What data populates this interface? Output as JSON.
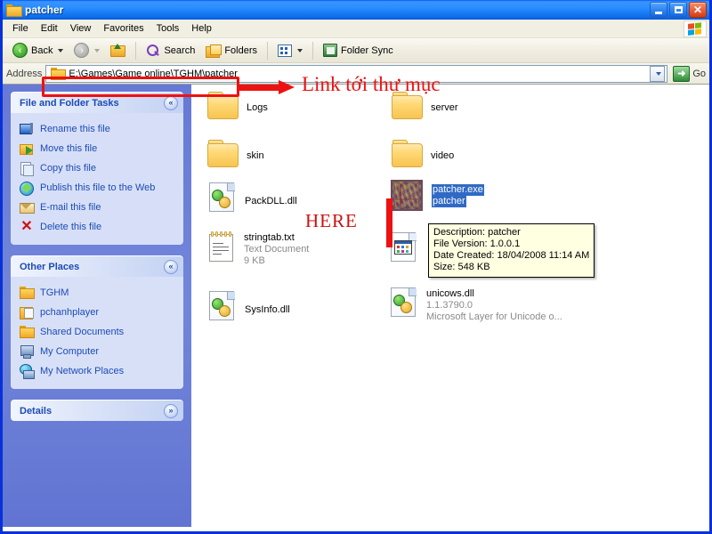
{
  "window": {
    "title": "patcher",
    "title_icon": "folder-icon",
    "buttons": {
      "minimize": "_",
      "maximize": "□",
      "close": "✕"
    }
  },
  "menu": {
    "items": [
      {
        "label": "File",
        "accel": "F"
      },
      {
        "label": "Edit",
        "accel": "E"
      },
      {
        "label": "View",
        "accel": "V"
      },
      {
        "label": "Favorites",
        "accel": "a"
      },
      {
        "label": "Tools",
        "accel": "T"
      },
      {
        "label": "Help",
        "accel": "H"
      }
    ],
    "flag_icon": "windows-flag-icon"
  },
  "toolbar": {
    "back_label": "Back",
    "back_icon": "back-arrow-icon",
    "forward_icon": "forward-arrow-icon",
    "up_icon": "up-folder-icon",
    "search_label": "Search",
    "search_icon": "search-icon",
    "folders_label": "Folders",
    "folders_icon": "folders-icon",
    "views_icon": "views-icon",
    "folder_sync_label": "Folder Sync",
    "folder_sync_icon": "folder-sync-icon"
  },
  "address": {
    "label": "Address",
    "value": "E:\\Games\\Game online\\TGHM\\patcher",
    "icon": "folder-icon",
    "dropdown_icon": "chevron-down-icon",
    "go_label": "Go",
    "go_icon": "go-arrow-icon"
  },
  "sidebar": {
    "panels": [
      {
        "title": "File and Folder Tasks",
        "collapse_icon": "chevron-up-icon",
        "collapse_glyph": "«",
        "items": [
          {
            "label": "Rename this file",
            "icon": "rename-icon"
          },
          {
            "label": "Move this file",
            "icon": "move-icon"
          },
          {
            "label": "Copy this file",
            "icon": "copy-icon"
          },
          {
            "label": "Publish this file to the Web",
            "icon": "publish-web-icon"
          },
          {
            "label": "E-mail this file",
            "icon": "email-icon"
          },
          {
            "label": "Delete this file",
            "icon": "delete-x-icon"
          }
        ]
      },
      {
        "title": "Other Places",
        "collapse_icon": "chevron-up-icon",
        "collapse_glyph": "«",
        "items": [
          {
            "label": "TGHM",
            "icon": "folder-icon"
          },
          {
            "label": "pchanhplayer",
            "icon": "user-folder-icon"
          },
          {
            "label": "Shared Documents",
            "icon": "folder-icon"
          },
          {
            "label": "My Computer",
            "icon": "my-computer-icon"
          },
          {
            "label": "My Network Places",
            "icon": "network-places-icon"
          }
        ]
      },
      {
        "title": "Details",
        "collapse_icon": "chevron-down-icon",
        "collapse_glyph": "»",
        "items": []
      }
    ]
  },
  "files": [
    {
      "name": "Logs",
      "type": "folder",
      "icon": "folder-icon",
      "selected": false,
      "sub1": "",
      "sub2": ""
    },
    {
      "name": "server",
      "type": "folder",
      "icon": "folder-icon",
      "selected": false,
      "sub1": "",
      "sub2": ""
    },
    {
      "name": "skin",
      "type": "folder",
      "icon": "folder-icon",
      "selected": false,
      "sub1": "",
      "sub2": ""
    },
    {
      "name": "video",
      "type": "folder",
      "icon": "folder-icon",
      "selected": false,
      "sub1": "",
      "sub2": ""
    },
    {
      "name": "PackDLL.dll",
      "type": "dll",
      "icon": "dll-icon",
      "selected": false,
      "sub1": "",
      "sub2": ""
    },
    {
      "name": "patcher.exe",
      "type": "exe",
      "icon": "patcher-app-icon",
      "selected": true,
      "sub1": "patcher",
      "sub2": ""
    },
    {
      "name": "stringtab.txt",
      "type": "txt",
      "icon": "text-document-icon",
      "selected": false,
      "sub1": "Text Document",
      "sub2": "9 KB"
    },
    {
      "name": "unicows.dll",
      "type": "dll",
      "icon": "dll-icon",
      "selected": false,
      "sub1": "1.1.3790.0",
      "sub2": "Microsoft Layer for Unicode o..."
    },
    {
      "name": "SysInfo.dll",
      "type": "dll",
      "icon": "dll-icon",
      "selected": false,
      "sub1": "",
      "sub2": ""
    }
  ],
  "hidden_file_icon": {
    "icon": "application-icon"
  },
  "tooltip": {
    "lines": [
      "Description: patcher",
      "File Version: 1.0.0.1",
      "Date Created: 18/04/2008 11:14 AM",
      "Size: 548 KB"
    ],
    "line1": "Description: patcher",
    "line2": "File Version: 1.0.0.1",
    "line3": "Date Created: 18/04/2008 11:14 AM",
    "line4": "Size: 548 KB"
  },
  "annotations": {
    "address_note": "Link tới thư mục",
    "here_note": "HERE",
    "color": "#ee1111"
  }
}
